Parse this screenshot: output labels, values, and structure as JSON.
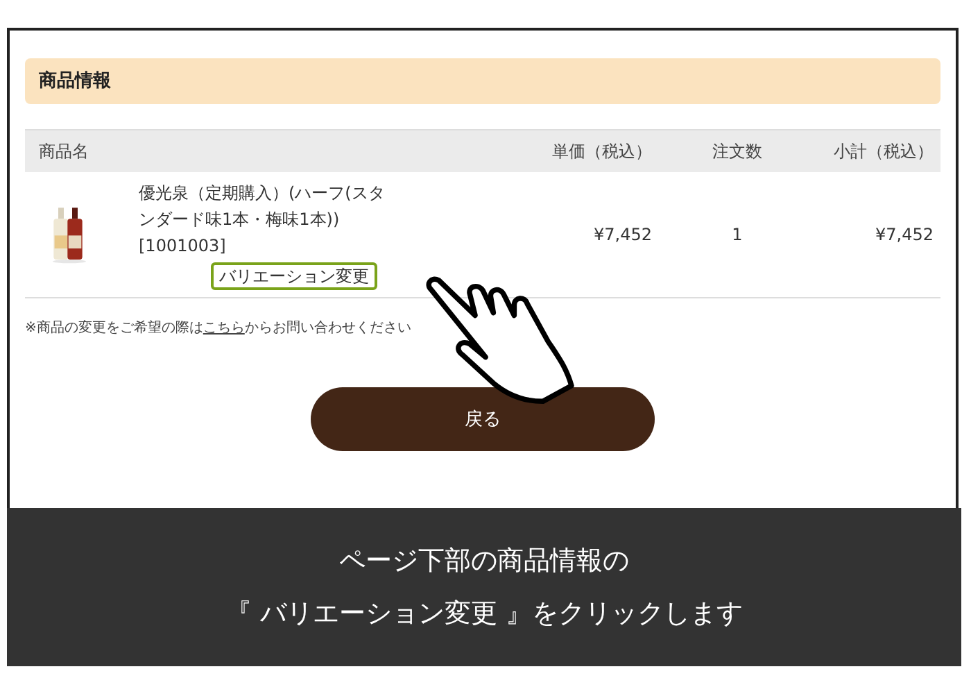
{
  "section": {
    "title": "商品情報"
  },
  "table": {
    "columns": [
      "商品名",
      "単価（税込）",
      "注文数",
      "小計（税込）"
    ],
    "rows": [
      {
        "name": "優光泉（定期購入）(ハーフ(スタンダード味1本・梅味1本))",
        "code": "[1001003]",
        "variation_button": "バリエーション変更",
        "highlighted": true,
        "unit_price": "¥7,452",
        "quantity": "1",
        "subtotal": "¥7,452"
      }
    ]
  },
  "note": {
    "before": "※商品の変更をご希望の際は",
    "link": "こちら",
    "after": "からお問い合わせください"
  },
  "back_button": "戻る",
  "caption": [
    "ページ下部の商品情報の",
    "『 バリエーション変更 』をクリックします"
  ]
}
